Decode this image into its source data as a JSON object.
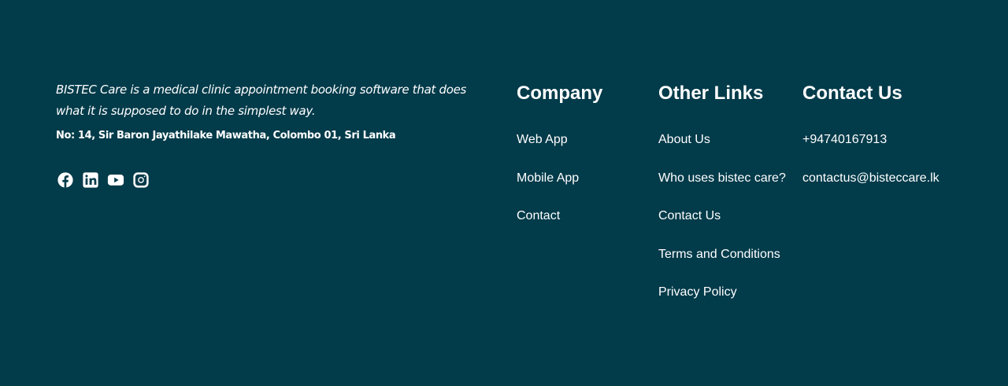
{
  "about": {
    "tagline": "BISTEC Care is a medical clinic appointment booking software that does what it is supposed to do in the simplest way.",
    "address": "No: 14, Sir Baron Jayathilake Mawatha, Colombo 01, Sri Lanka"
  },
  "socials": [
    {
      "icon": "facebook-icon"
    },
    {
      "icon": "linkedin-icon"
    },
    {
      "icon": "youtube-icon"
    },
    {
      "icon": "instagram-icon"
    }
  ],
  "company": {
    "heading": "Company",
    "links": [
      "Web App",
      "Mobile App",
      "Contact"
    ]
  },
  "other_links": {
    "heading": "Other Links",
    "links": [
      "About Us",
      "Who uses bistec care?",
      "Contact Us",
      "Terms and Conditions",
      "Privacy Policy"
    ]
  },
  "contact": {
    "heading": "Contact Us",
    "phone": "+94740167913",
    "email": "contactus@bisteccare.lk"
  },
  "colors": {
    "background": "#023b4a",
    "text": "#ffffff"
  }
}
